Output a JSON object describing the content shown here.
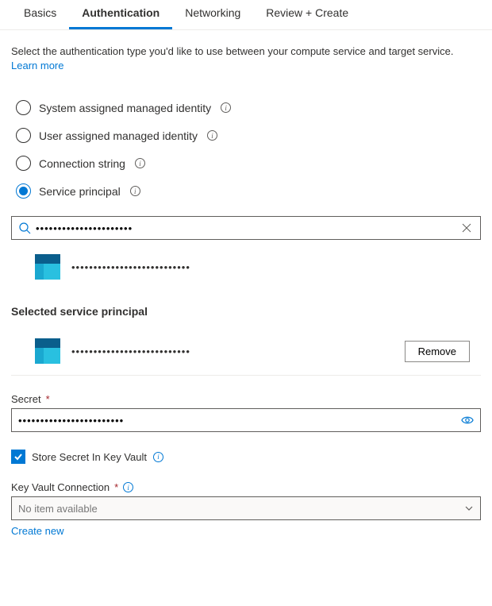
{
  "tabs": {
    "basics": "Basics",
    "authentication": "Authentication",
    "networking": "Networking",
    "review": "Review + Create"
  },
  "description": "Select the authentication type you'd like to use between your compute service and target service.",
  "learn_more": "Learn more",
  "auth_options": {
    "system": "System assigned managed identity",
    "user": "User assigned managed identity",
    "connstr": "Connection string",
    "sp": "Service principal"
  },
  "search_value": "••••••••••••••••••••••",
  "result_name": "•••••••••••••••••••••••••••",
  "selected_heading": "Selected service principal",
  "selected_name": "•••••••••••••••••••••••••••",
  "remove_label": "Remove",
  "secret_label": "Secret",
  "secret_value": "••••••••••••••••••••••••",
  "store_label": "Store Secret In Key Vault",
  "kv_label": "Key Vault Connection",
  "kv_placeholder": "No item available",
  "create_new": "Create new"
}
